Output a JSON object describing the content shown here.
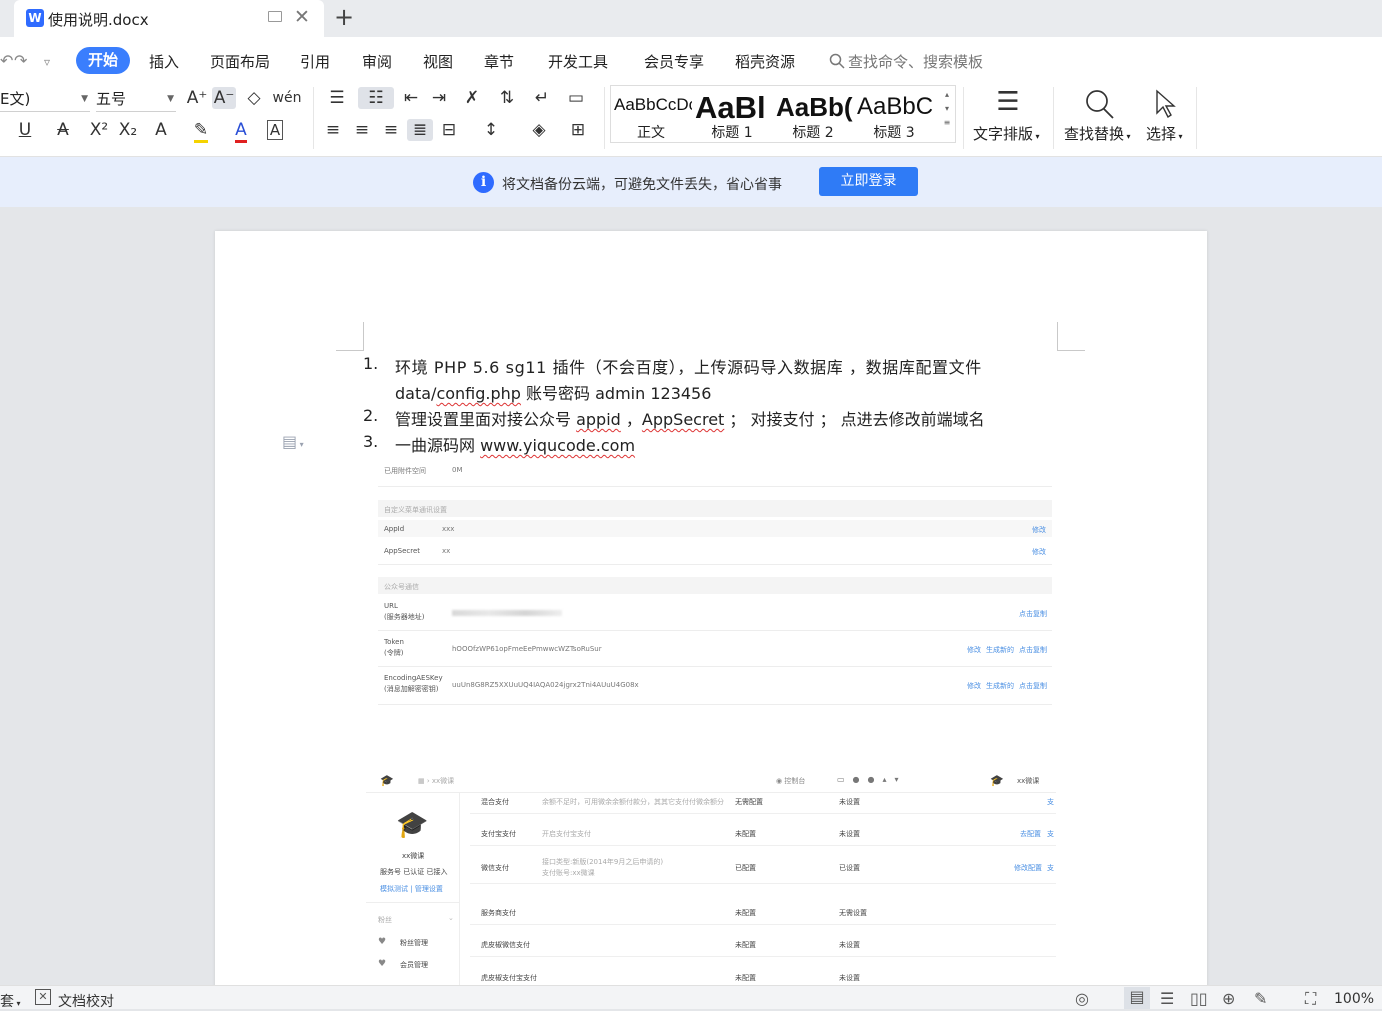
{
  "window": {
    "tab_title": "使用说明.docx",
    "tab_logo": "W",
    "new_tab": "+",
    "close_glyph": "✕"
  },
  "menu": {
    "items": [
      "开始",
      "插入",
      "页面布局",
      "引用",
      "审阅",
      "视图",
      "章节",
      "开发工具",
      "会员专享",
      "稻壳资源"
    ],
    "search_placeholder": "查找命令、搜索模板"
  },
  "ribbon": {
    "font_name": "E文)",
    "font_size": "五号",
    "styles": [
      {
        "sample": "AaBbCcDc",
        "label": "正文"
      },
      {
        "sample": "AaBl",
        "label": "标题 1"
      },
      {
        "sample": "AaBb(",
        "label": "标题 2"
      },
      {
        "sample": "AaBbC",
        "label": "标题 3"
      }
    ],
    "text_layout_label": "文字排版",
    "find_replace_label": "查找替换",
    "select_label": "选择"
  },
  "notice": {
    "icon": "i",
    "text": "将文档备份云端，可避免文件丢失，省心省事",
    "button": "立即登录"
  },
  "document": {
    "list": [
      {
        "num": "1.",
        "line1": "环境 PHP 5.6 sg11 插件（不会百度），上传源码导入数据库 ，数据库配置文件",
        "line2_a": "data/",
        "line2_b": "config.php",
        "line2_c": " 账号密码 admin 123456"
      },
      {
        "num": "2.",
        "part_a": "管理设置里面对接公众号 ",
        "part_b": "appid",
        "part_c": " ，",
        "part_d": "AppSecret",
        "part_e": " ； 对接支付 ； 点进去修改前端域名"
      },
      {
        "num": "3.",
        "part_a": "一曲源码网  ",
        "part_b": "www.yiqucode.com"
      }
    ]
  },
  "embedded1": {
    "attachment_label": "已用附件空间",
    "attachment_value": "0M",
    "section1": "自定义菜单通讯设置",
    "appid_label": "AppId",
    "appid_value": "xxx",
    "secret_label": "AppSecret",
    "secret_value": "xx",
    "edit": "修改",
    "section2": "公众号通信",
    "url_label": "URL",
    "url_sub": "(服务器地址)",
    "copy": "点击复制",
    "token_label": "Token",
    "token_sub": "(令牌)",
    "token_value": "hOOOfzWP61opFmeEePmwwcWZTsoRuSur",
    "generate": "生成新的",
    "aes_label": "EncodingAESKey",
    "aes_sub": "(消息加解密密钥)",
    "aes_value": "uuUn8G8RZ5XXUuUQ4IAQA024jgrx2Tni4AUuU4G08x"
  },
  "embedded2": {
    "breadcrumb": "xx微课",
    "console": "控制台",
    "brand": "xx微课",
    "service_status": "服务号 已认证 已接入",
    "simulate": "模拟测试",
    "separator": "|",
    "manage": "管理设置",
    "fans": "粉丝",
    "fans_mgmt": "粉丝管理",
    "member_mgmt": "会员管理",
    "rows": [
      {
        "name": "混合支付",
        "desc": "余额不足时，可用微余余额付款分，其其它支付付微余额分",
        "s1": "无需配置",
        "s2": "未设置",
        "act": "",
        "act2": "支"
      },
      {
        "name": "支付宝支付",
        "desc": "开启支付宝支付",
        "s1": "未配置",
        "s2": "未设置",
        "act": "去配置",
        "act2": "支"
      },
      {
        "name": "微信支付",
        "desc": "接口类型:新版(2014年9月之后申请的)",
        "desc2": "支付账号:xx微课",
        "s1": "已配置",
        "s2": "已设置",
        "act": "修改配置",
        "act2": "支"
      },
      {
        "name": "服务商支付",
        "desc": "",
        "s1": "未配置",
        "s2": "无需设置",
        "act": "",
        "act2": ""
      },
      {
        "name": "虎皮椒微信支付",
        "desc": "",
        "s1": "未配置",
        "s2": "未设置",
        "act": "",
        "act2": ""
      },
      {
        "name": "虎皮椒支付宝支付",
        "desc": "",
        "s1": "未配置",
        "s2": "未设置",
        "act": "",
        "act2": ""
      }
    ]
  },
  "status": {
    "left_partial": "套",
    "proofread": "文档校对",
    "zoom": "100%"
  },
  "colors": {
    "accent": "#3a7efd",
    "notice_bg": "#e7eefc",
    "link": "#4a8fe3",
    "spell": "#dd3333"
  }
}
